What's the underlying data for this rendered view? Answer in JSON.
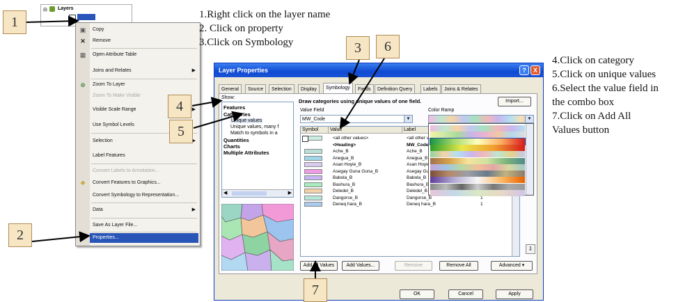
{
  "instructions_top": [
    "1.Right click on the layer name",
    "2. Click on property",
    "3.Click on Symbology"
  ],
  "instructions_right": [
    "4.Click on category",
    "5.Click on unique values",
    "6.Select the value field in",
    "the combo box",
    "7.Click on Add All",
    "Values button"
  ],
  "callouts": [
    "1",
    "2",
    "3",
    "6",
    "4",
    "5",
    "7"
  ],
  "toc": {
    "root": "Layers"
  },
  "context_menu": {
    "items": [
      {
        "label": "Copy",
        "icon": "copy-icon"
      },
      {
        "label": "Remove",
        "icon": "remove-icon"
      },
      {
        "label": "Open Attribute Table",
        "icon": "table-icon"
      },
      {
        "label": "Joins and Relates",
        "submenu": true
      },
      {
        "label": "Zoom To Layer",
        "icon": "zoom-icon"
      },
      {
        "label": "Zoom To Make Visible",
        "disabled": true
      },
      {
        "label": "Visible Scale Range",
        "submenu": true
      },
      {
        "label": "Use Symbol Levels"
      },
      {
        "label": "Selection",
        "submenu": true
      },
      {
        "label": "Label Features"
      },
      {
        "label": "Convert Labels to Annotation...",
        "disabled": true
      },
      {
        "label": "Convert Features to Graphics...",
        "icon": "convert-icon"
      },
      {
        "label": "Convert Symbology to Representation..."
      },
      {
        "label": "Data",
        "submenu": true
      },
      {
        "label": "Save As Layer File..."
      },
      {
        "label": "Properties...",
        "selected": true
      }
    ]
  },
  "dialog": {
    "title": "Layer Properties",
    "help": "?",
    "close": "X",
    "tabs": [
      "General",
      "Source",
      "Selection",
      "Display",
      "Symbology",
      "Fields",
      "Definition Query",
      "Labels",
      "Joins & Relates"
    ],
    "active_tab": "Symbology",
    "show_label": "Show:",
    "show_tree": [
      {
        "label": "Features",
        "bold": true
      },
      {
        "label": "Categories",
        "bold": true
      },
      {
        "label": "Unique values",
        "indent": true,
        "selected": true
      },
      {
        "label": "Unique values, many f",
        "indent": true
      },
      {
        "label": "Match to symbols in a",
        "indent": true
      },
      {
        "label": "Quantities",
        "bold": true
      },
      {
        "label": "Charts",
        "bold": true
      },
      {
        "label": "Multiple Attributes",
        "bold": true
      }
    ],
    "heading": "Draw categories using unique values of one field.",
    "import_label": "Import...",
    "value_field_label": "Value Field",
    "value_field": "MW_Code",
    "color_ramp_label": "Color Ramp",
    "grid_headers": [
      "Symbol",
      "Value",
      "Label"
    ],
    "rows": [
      {
        "value": "<all other values>",
        "label": "<all other values>",
        "count": "",
        "color": "#cceee0"
      },
      {
        "value": "<Heading>",
        "label": "MW_Code",
        "count": "",
        "color": "",
        "bold": true
      },
      {
        "value": "Ache_B",
        "label": "Ache_B",
        "count": "1",
        "color": "#b8e0d8"
      },
      {
        "value": "Anegua_B",
        "label": "Anegua_B",
        "count": "1",
        "color": "#9fd7e8"
      },
      {
        "value": "Asan Hoyie_B",
        "label": "Asan Hoyie_B",
        "count": "1",
        "color": "#d8c9ef"
      },
      {
        "value": "Asegay Guna Guna_B",
        "label": "Asegay Guna Guna_B",
        "count": "1",
        "color": "#f09ae6"
      },
      {
        "value": "Babola_B",
        "label": "Babola_B",
        "count": "1",
        "color": "#c6b6f2"
      },
      {
        "value": "Bashura_B",
        "label": "Bashura_B",
        "count": "1",
        "color": "#a8ecc0"
      },
      {
        "value": "Deledel_B",
        "label": "Deledel_B",
        "count": "1",
        "color": "#f2d3a8"
      },
      {
        "value": "Dangorse_B",
        "label": "Dangorse_B",
        "count": "1",
        "color": "#b6e6d8"
      },
      {
        "value": "Deneq hara_B",
        "label": "Deneq hara_B",
        "count": "1",
        "color": "#a8cbee"
      }
    ],
    "buttons": [
      "Add All Values",
      "Add Values...",
      "Remove",
      "Remove All",
      "Advanced"
    ],
    "footer": [
      "OK",
      "Cancel",
      "Apply"
    ]
  },
  "colors": {
    "accent": "#0f4bd3",
    "selection": "#2a55b8",
    "callout": "#f7e6c4"
  }
}
